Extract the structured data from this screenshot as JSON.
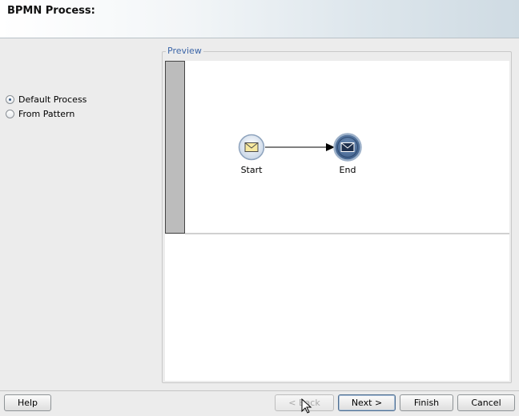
{
  "header": {
    "title": "BPMN Process:"
  },
  "options": {
    "items": [
      {
        "label": "Default Process",
        "selected": true
      },
      {
        "label": "From Pattern",
        "selected": false
      }
    ]
  },
  "preview": {
    "group_label": "Preview",
    "start_label": "Start",
    "end_label": "End",
    "start_icon": "envelope-icon",
    "end_icon": "envelope-filled-icon",
    "accent_color": "#3f5f8a"
  },
  "footer": {
    "help": "Help",
    "back": "< Back",
    "next": "Next >",
    "finish": "Finish",
    "cancel": "Cancel"
  }
}
